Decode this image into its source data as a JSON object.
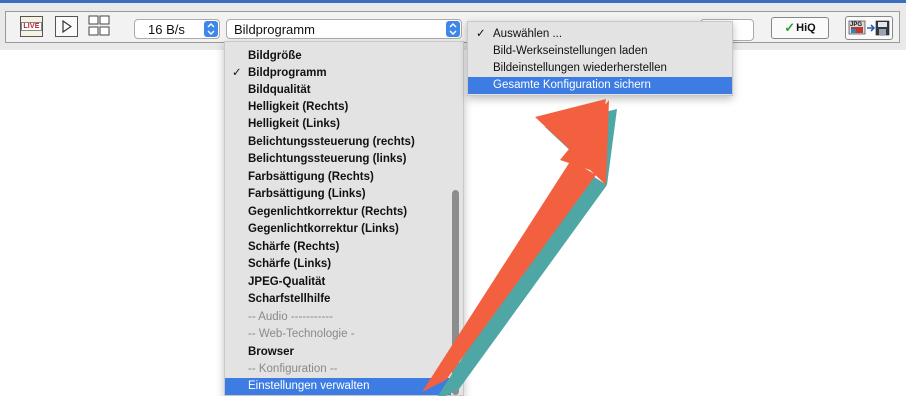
{
  "toolbar": {
    "live_label": "LIVE",
    "fps_value": "16 B/s",
    "program_value": "Bildprogramm",
    "hiq_label": "HiQ",
    "jpg_label": "JPG"
  },
  "program_menu": {
    "items": [
      {
        "label": "Bildgröße"
      },
      {
        "label": "Bildprogramm",
        "checked": true
      },
      {
        "label": "Bildqualität"
      },
      {
        "label": "Helligkeit (Rechts)"
      },
      {
        "label": "Helligkeit (Links)"
      },
      {
        "label": "Belichtungssteuerung (rechts)"
      },
      {
        "label": "Belichtungssteuerung (links)"
      },
      {
        "label": "Farbsättigung (Rechts)"
      },
      {
        "label": "Farbsättigung (Links)"
      },
      {
        "label": "Gegenlichtkorrektur (Rechts)"
      },
      {
        "label": "Gegenlichtkorrektur (Links)"
      },
      {
        "label": "Schärfe (Rechts)"
      },
      {
        "label": "Schärfe (Links)"
      },
      {
        "label": "JPEG-Qualität"
      },
      {
        "label": "Scharfstellhilfe"
      },
      {
        "label": "-- Audio -----------",
        "disabled": true
      },
      {
        "label": "-- Web-Technologie -",
        "disabled": true
      },
      {
        "label": "Browser"
      },
      {
        "label": "-- Konfiguration --",
        "disabled": true
      },
      {
        "label": "Einstellungen verwalten",
        "selected": true
      }
    ]
  },
  "action_menu": {
    "items": [
      {
        "label": "Auswählen ...",
        "checked": true
      },
      {
        "label": "Bild-Werkseinstellungen laden"
      },
      {
        "label": "Bildeinstellungen wiederherstellen"
      },
      {
        "label": "Gesamte Konfiguration sichern",
        "selected": true
      }
    ]
  },
  "colors": {
    "selection": "#3d7de3",
    "arrow": "#f2603f",
    "arrow_shadow": "#4fa7a5",
    "stepper": "#3f88e8",
    "hiq_check": "#2ea12e",
    "toolbar_top_border": "#3a6fbf"
  },
  "icons": {
    "play": "play-icon",
    "grid": "grid-icon",
    "stepper": "stepper-icon",
    "hiq_check": "checkmark-icon",
    "jpg_export": "jpg-to-disk-icon"
  }
}
